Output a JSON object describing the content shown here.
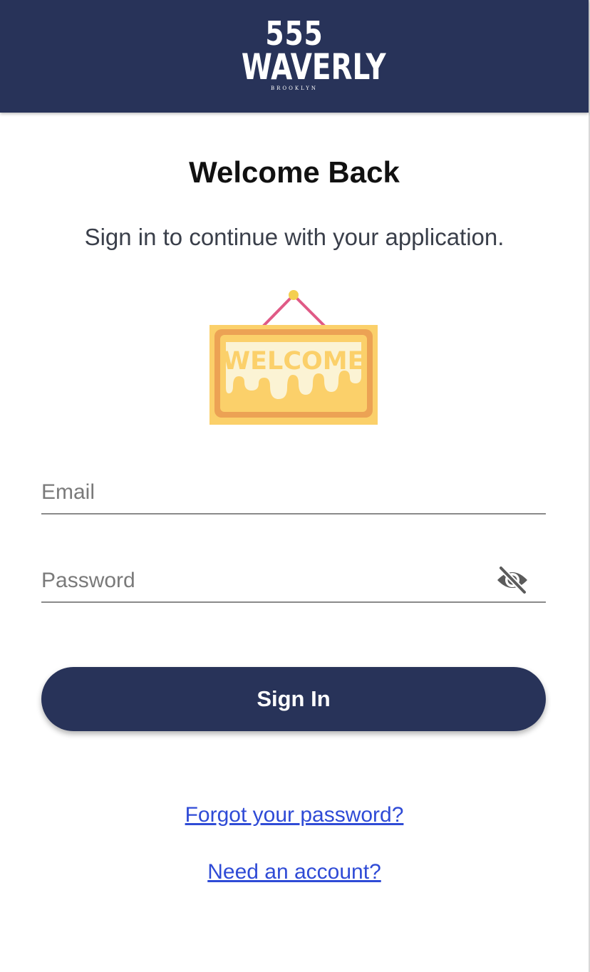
{
  "header": {
    "logo_number": "555",
    "logo_name": "WAVERLY",
    "logo_sub": "BROOKLYN",
    "background": "#283359"
  },
  "main": {
    "title": "Welcome Back",
    "subtitle": "Sign in to continue with your application.",
    "sign_text": "WELCOME"
  },
  "form": {
    "email_placeholder": "Email",
    "email_value": "",
    "password_placeholder": "Password",
    "password_value": "",
    "password_toggle_icon": "eye-off-icon",
    "signin_label": "Sign In"
  },
  "links": {
    "forgot_password": "Forgot your password?",
    "need_account": "Need an account?"
  },
  "colors": {
    "brand": "#283359",
    "link": "#2f4bd6"
  }
}
